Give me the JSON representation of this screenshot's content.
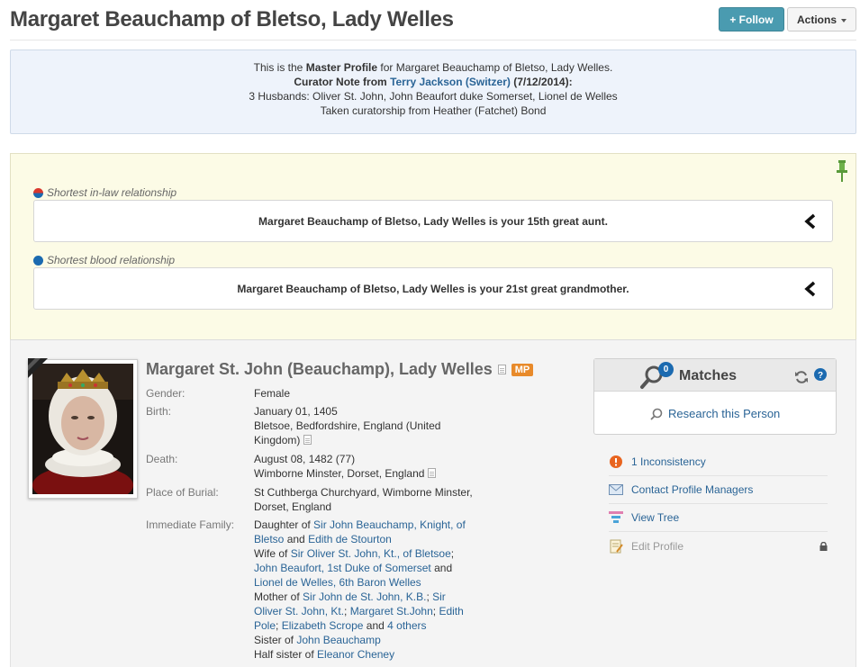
{
  "header": {
    "title": "Margaret Beauchamp of Bletso, Lady Welles",
    "follow_label": "+ Follow",
    "actions_label": "Actions"
  },
  "master": {
    "line1_prefix": "This is the ",
    "line1_bold": "Master Profile",
    "line1_suffix": " for Margaret Beauchamp of Bletso, Lady Welles.",
    "curator_prefix": "Curator Note from ",
    "curator_name": "Terry Jackson (Switzer)",
    "curator_date": " (7/12/2014):",
    "note_line1": "3 Husbands: Oliver St. John, John Beaufort duke Somerset, Lionel de Welles",
    "note_line2": "Taken curatorship from Heather (Fatchet) Bond"
  },
  "relationships": {
    "inlaw_label": "Shortest in-law relationship",
    "inlaw_text": "Margaret Beauchamp of Bletso, Lady Welles is your 15th great aunt.",
    "blood_label": "Shortest blood relationship",
    "blood_text": "Margaret Beauchamp of Bletso, Lady Welles is your 21st great grandmother."
  },
  "profile": {
    "name": "Margaret St. John (Beauchamp), Lady Welles",
    "badge": "MP",
    "gender_label": "Gender:",
    "gender": "Female",
    "birth_label": "Birth:",
    "birth_date": "January 01, 1405",
    "birth_place": "Bletsoe, Bedfordshire, England (United Kingdom)",
    "death_label": "Death:",
    "death_date": "August 08, 1482 (77)",
    "death_place": "Wimborne Minster, Dorset, England",
    "burial_label": "Place of Burial:",
    "burial": "St Cuthberga Churchyard, Wimborne Minster, Dorset, England",
    "family_label": "Immediate Family:",
    "family": {
      "daughter_of": "Daughter of ",
      "father": "Sir John Beauchamp, Knight, of Bletso",
      "and1": " and ",
      "mother": "Edith de Stourton",
      "wife_of": "Wife of ",
      "husband1": "Sir Oliver St. John, Kt., of Bletsoe",
      "sep1": "; ",
      "husband2": "John Beaufort, 1st Duke of Somerset",
      "and2": " and ",
      "husband3": "Lionel de Welles, 6th Baron Welles",
      "mother_of": "Mother of ",
      "child1": "Sir John de St. John, K.B.",
      "sep2": "; ",
      "child2": "Sir Oliver St. John, Kt.",
      "sep3": "; ",
      "child3": "Margaret St.John",
      "sep4": "; ",
      "child4": "Edith Pole",
      "sep5": "; ",
      "child5": "Elizabeth Scrope",
      "and3": " and ",
      "others": "4 others",
      "sister_of": "Sister of ",
      "sibling": "John Beauchamp",
      "half_sister_of": "Half sister of ",
      "half_sibling": "Eleanor Cheney"
    }
  },
  "matches": {
    "title": "Matches",
    "count": "0",
    "research": "Research this Person"
  },
  "sidebar": {
    "inconsistency": "1 Inconsistency",
    "contact": "Contact Profile Managers",
    "view_tree": "View Tree",
    "edit_profile": "Edit Profile"
  },
  "colors": {
    "follow": "#4a9bb0",
    "master_bg": "#eef3fb",
    "relationship_bg": "#fcfbe6",
    "link": "#2a6496",
    "badge": "#e88a2a",
    "count": "#1b6ab0"
  }
}
